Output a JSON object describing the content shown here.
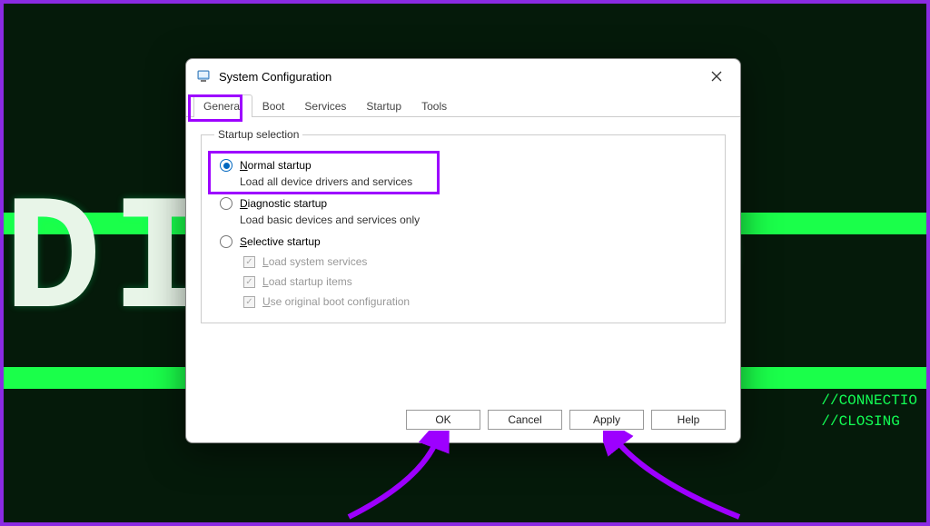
{
  "highlight_color": "#9d00ff",
  "background": {
    "big_text": "DIS          TED",
    "term_lines": [
      "//CONNECTIO",
      "//CLOSING"
    ]
  },
  "dialog": {
    "title": "System Configuration",
    "tabs": [
      "General",
      "Boot",
      "Services",
      "Startup",
      "Tools"
    ],
    "active_tab": "General",
    "group_label": "Startup selection",
    "options": [
      {
        "label_underlined": "N",
        "label_rest": "ormal startup",
        "desc": "Load all device drivers and services",
        "selected": true
      },
      {
        "label_underlined": "D",
        "label_rest": "iagnostic startup",
        "desc": "Load basic devices and services only",
        "selected": false
      },
      {
        "label_underlined": "S",
        "label_rest": "elective startup",
        "selected": false,
        "checks": [
          {
            "label_u": "L",
            "label_rest": "oad system services",
            "checked": true,
            "disabled": true
          },
          {
            "label_u": "L",
            "label_rest": "oad startup items",
            "checked": true,
            "disabled": true
          },
          {
            "label_u": "U",
            "label_rest": "se original boot configuration",
            "checked": true,
            "disabled": true
          }
        ]
      }
    ],
    "buttons": {
      "ok": "OK",
      "cancel": "Cancel",
      "apply": "Apply",
      "help": "Help"
    }
  }
}
